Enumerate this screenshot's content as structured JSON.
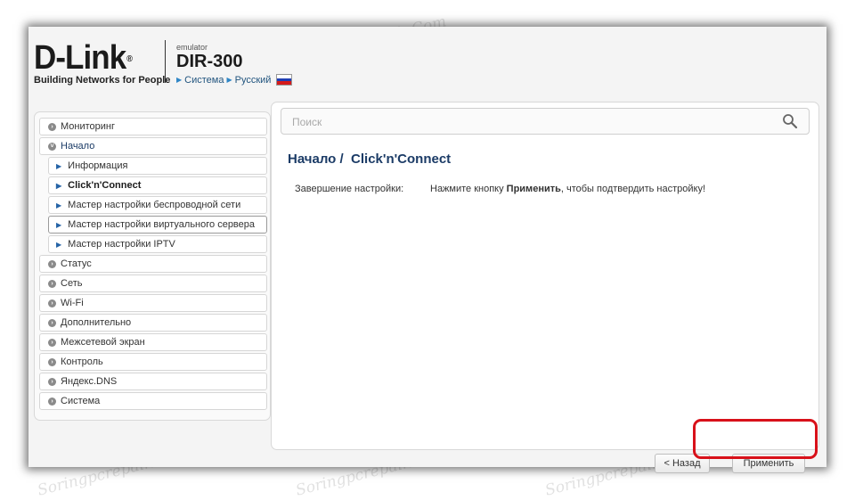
{
  "header": {
    "logo_text": "D-Link",
    "logo_reg": "®",
    "tagline": "Building Networks for People",
    "emulator_label": "emulator",
    "model": "DIR-300",
    "crumb_system": "Система",
    "crumb_language": "Русский"
  },
  "flag_colors": [
    "#ffffff",
    "#1f3fb4",
    "#d51a1a"
  ],
  "search": {
    "placeholder": "Поиск"
  },
  "sidebar": {
    "items": [
      {
        "label": "Мониторинг"
      },
      {
        "label": "Начало"
      },
      {
        "label": "Информация"
      },
      {
        "label": "Click'n'Connect"
      },
      {
        "label": "Мастер настройки беспроводной сети"
      },
      {
        "label": "Мастер настройки виртуального сервера"
      },
      {
        "label": "Мастер настройки IPTV"
      },
      {
        "label": "Статус"
      },
      {
        "label": "Сеть"
      },
      {
        "label": "Wi-Fi"
      },
      {
        "label": "Дополнительно"
      },
      {
        "label": "Межсетевой экран"
      },
      {
        "label": "Контроль"
      },
      {
        "label": "Яндекс.DNS"
      },
      {
        "label": "Система"
      }
    ]
  },
  "main": {
    "title_prefix": "Начало /",
    "title_page": "Click'n'Connect",
    "row_label": "Завершение настройки:",
    "row_text_before": "Нажмите кнопку ",
    "row_text_bold": "Применить",
    "row_text_after": ", чтобы подтвердить настройку!"
  },
  "buttons": {
    "back": "< Назад",
    "apply": "Применить"
  },
  "watermark": "Soringpcrepair.Com",
  "highlight_color": "#d8111a"
}
